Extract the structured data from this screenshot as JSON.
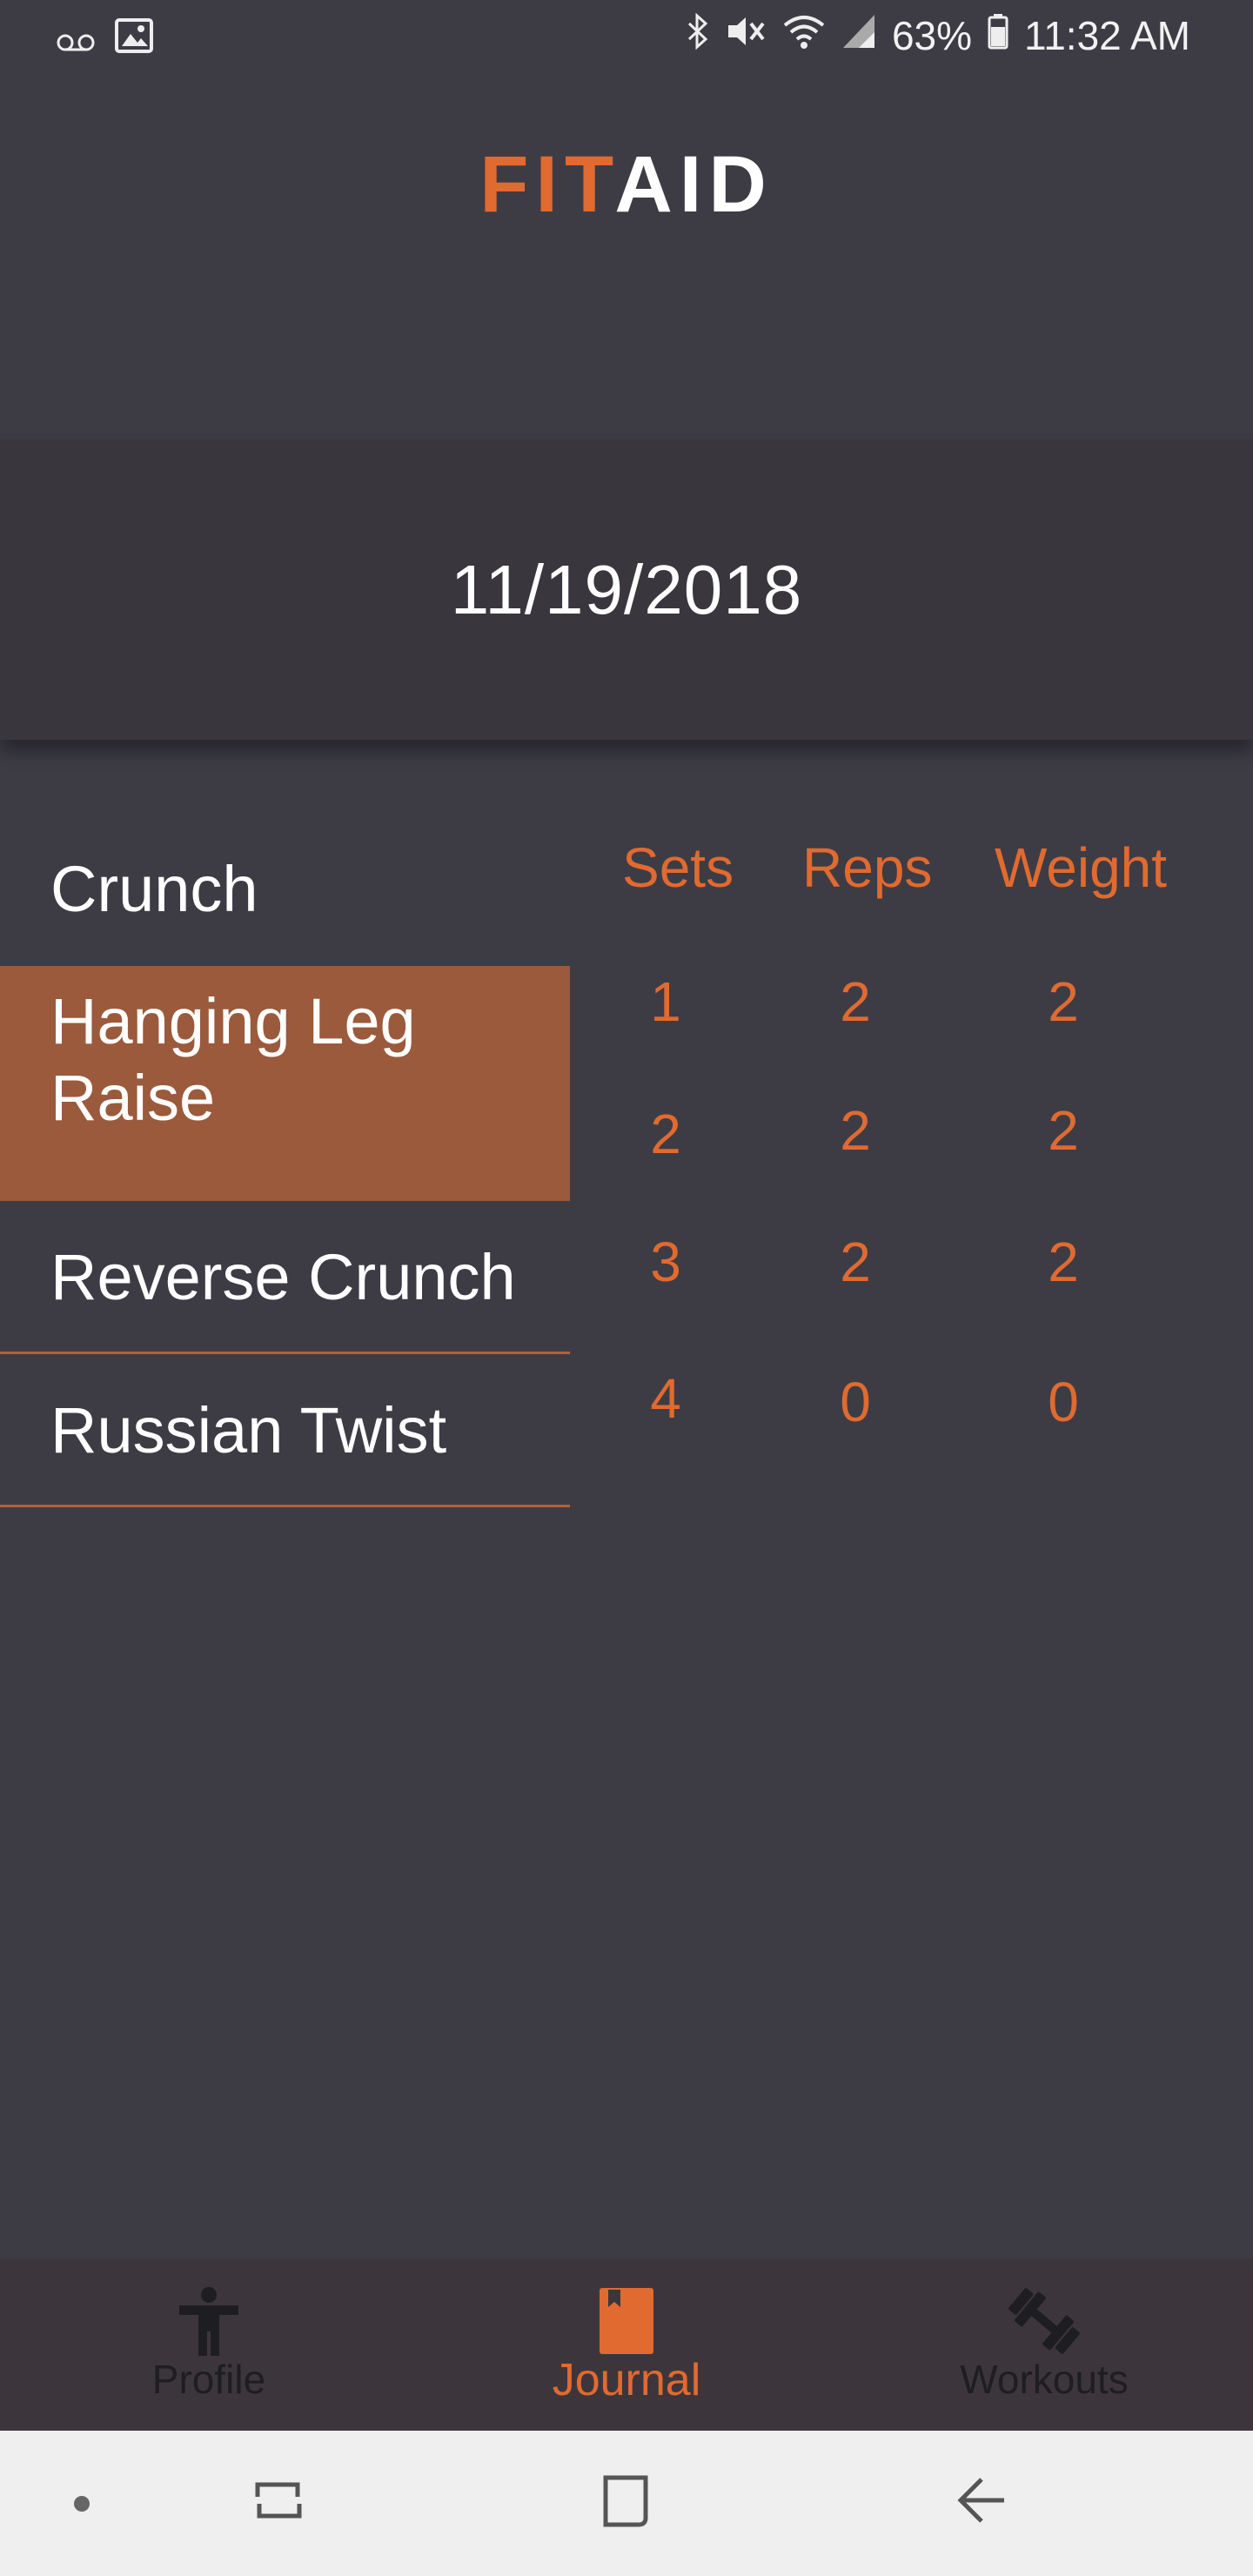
{
  "status_bar": {
    "battery": "63%",
    "time": "11:32 AM",
    "icons": [
      "voicemail-icon",
      "image-icon",
      "bluetooth-icon",
      "mute-icon",
      "wifi-icon",
      "signal-icon",
      "battery-icon"
    ]
  },
  "header": {
    "logo_fit": "FIT",
    "logo_aid": "AID"
  },
  "date": "11/19/2018",
  "exercises": [
    "Crunch",
    "Hanging Leg Raise",
    "Reverse Crunch",
    "Russian Twist"
  ],
  "selected_exercise": "Hanging Leg Raise",
  "table": {
    "headers": {
      "sets": "Sets",
      "reps": "Reps",
      "weight": "Weight"
    },
    "rows": [
      {
        "set": "1",
        "reps": "2",
        "weight": "2"
      },
      {
        "set": "2",
        "reps": "2",
        "weight": "2"
      },
      {
        "set": "3",
        "reps": "2",
        "weight": "2"
      },
      {
        "set": "4",
        "reps": "0",
        "weight": "0"
      }
    ]
  },
  "bottom_nav": {
    "profile": "Profile",
    "journal": "Journal",
    "workouts": "Workouts",
    "active": "Journal"
  },
  "colors": {
    "accent": "#e06a30",
    "background": "#3d3c45",
    "selected": "#9b5a3c",
    "nav_background": "#3c363c"
  }
}
